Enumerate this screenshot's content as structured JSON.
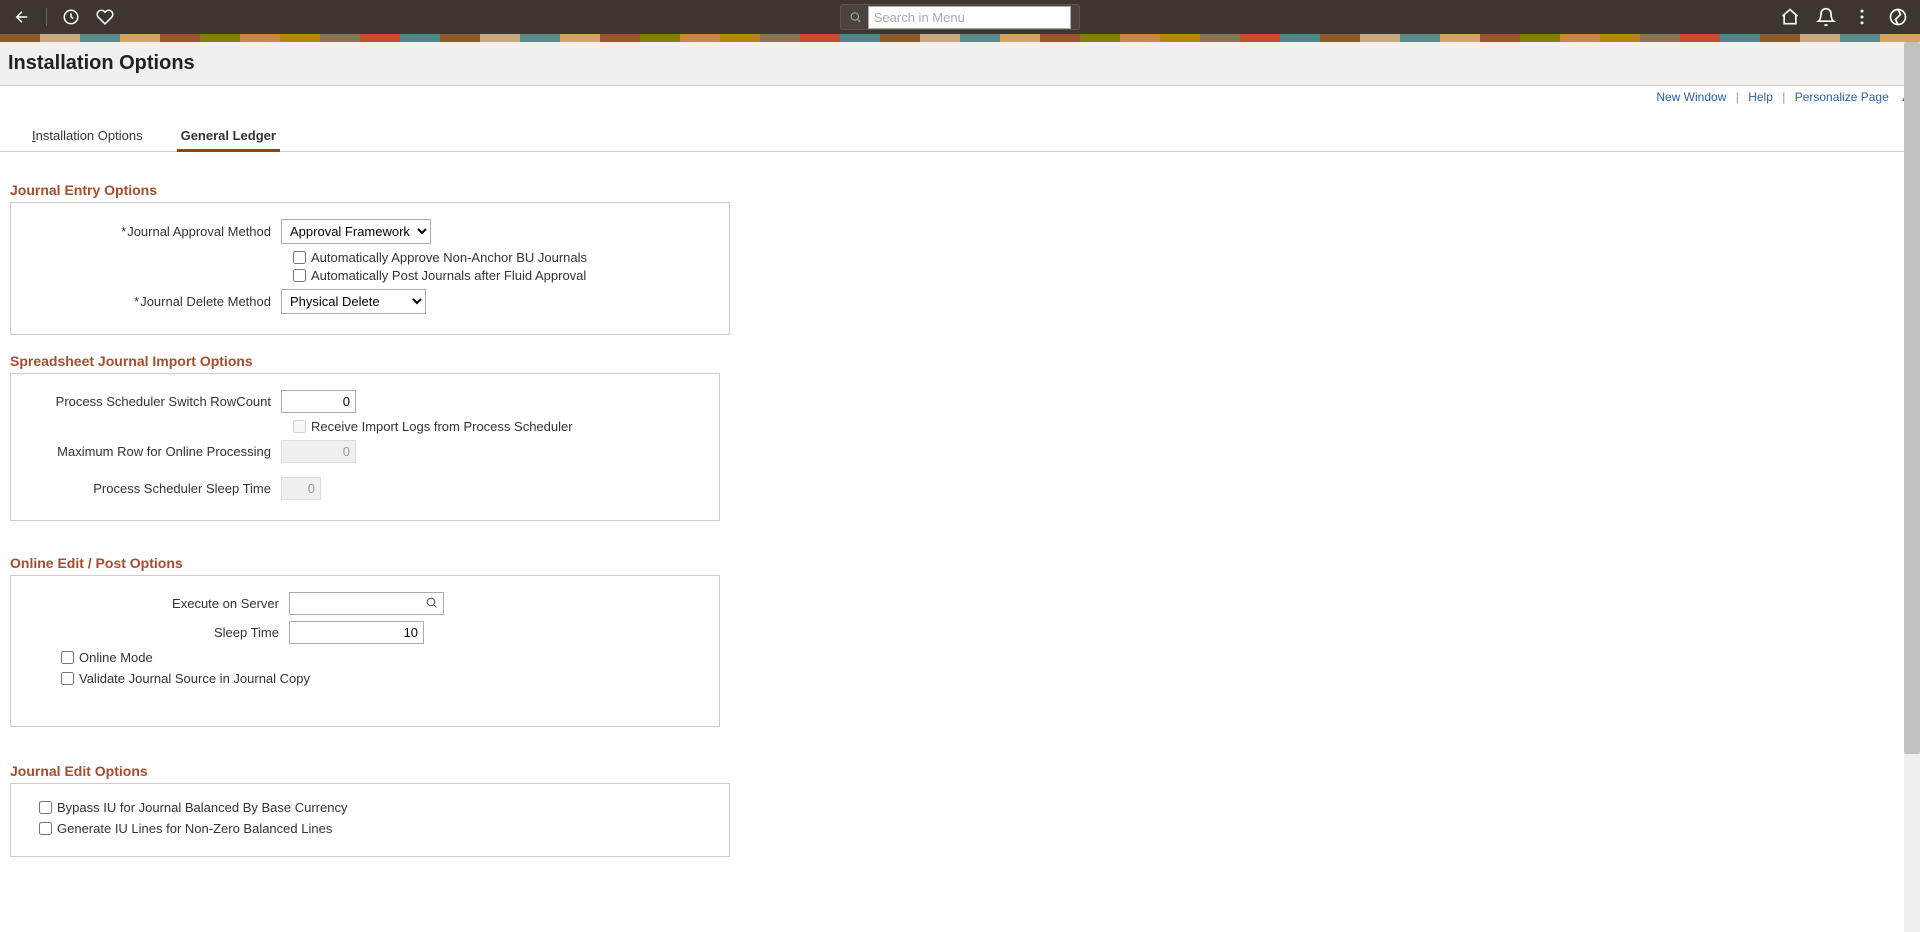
{
  "topbar": {
    "search_placeholder": "Search in Menu"
  },
  "page": {
    "title": "Installation Options"
  },
  "links": {
    "new_window": "New Window",
    "help": "Help",
    "personalize": "Personalize Page"
  },
  "tabs": {
    "installation_options_prefix": "I",
    "installation_options_rest": "nstallation Options",
    "general_ledger": "General Ledger"
  },
  "sections": {
    "journal_entry": {
      "title": "Journal Entry Options",
      "approval_method_label": "Journal Approval Method",
      "approval_method_value": "Approval Framework",
      "auto_approve_non_anchor": "Automatically Approve Non-Anchor BU Journals",
      "auto_post_fluid": "Automatically Post Journals after Fluid Approval",
      "delete_method_label": "Journal Delete Method",
      "delete_method_value": "Physical Delete"
    },
    "spreadsheet": {
      "title": "Spreadsheet Journal Import Options",
      "switch_rowcount_label": "Process Scheduler Switch RowCount",
      "switch_rowcount_value": "0",
      "receive_logs": "Receive Import Logs from Process Scheduler",
      "max_row_label": "Maximum Row for Online Processing",
      "max_row_value": "0",
      "sleep_time_label": "Process Scheduler Sleep Time",
      "sleep_time_value": "0"
    },
    "online_edit": {
      "title": "Online Edit / Post Options",
      "execute_server_label": "Execute on Server",
      "execute_server_value": "",
      "sleep_time_label": "Sleep Time",
      "sleep_time_value": "10",
      "online_mode": "Online Mode",
      "validate_source": "Validate Journal Source in Journal Copy"
    },
    "journal_edit": {
      "title": "Journal Edit Options",
      "bypass_iu": "Bypass IU for Journal Balanced By Base Currency",
      "generate_iu": "Generate IU Lines for Non-Zero Balanced Lines"
    }
  }
}
